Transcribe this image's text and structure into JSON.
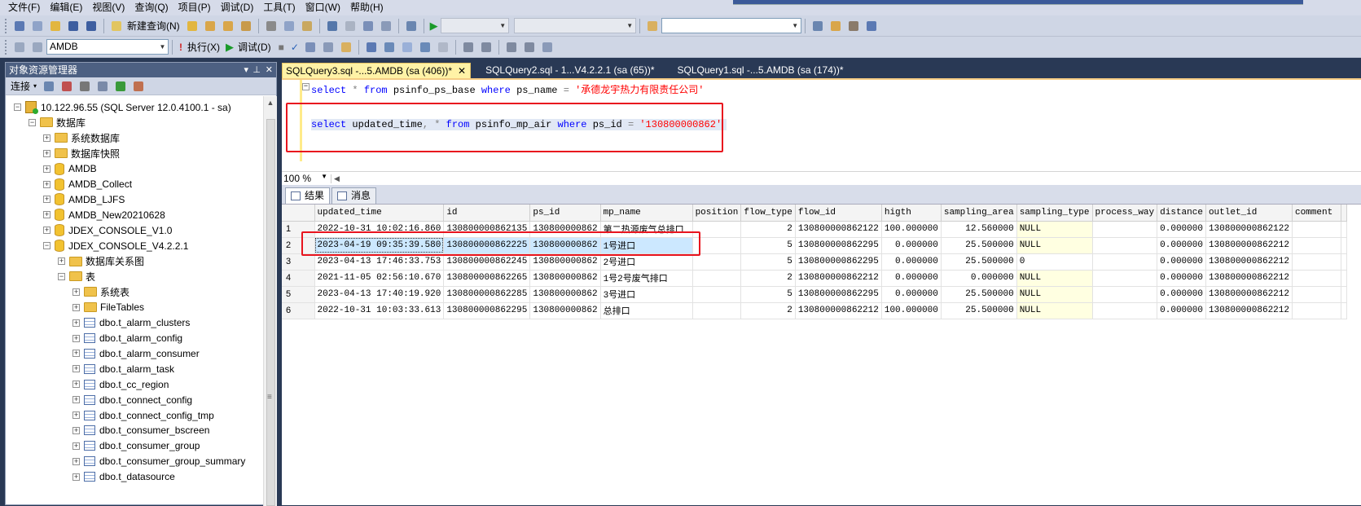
{
  "menu": [
    "文件(F)",
    "编辑(E)",
    "视图(V)",
    "查询(Q)",
    "项目(P)",
    "调试(D)",
    "工具(T)",
    "窗口(W)",
    "帮助(H)"
  ],
  "toolbar1": {
    "new_query": "新建查询(N)"
  },
  "toolbar2": {
    "database": "AMDB",
    "execute": "执行(X)",
    "debug": "调试(D)"
  },
  "explorer": {
    "title": "对象资源管理器",
    "connect": "连接",
    "tree": [
      {
        "label": "10.122.96.55 (SQL Server 12.0.4100.1 - sa)",
        "icon": "server-icon",
        "level": 0,
        "toggle": "−"
      },
      {
        "label": "数据库",
        "icon": "folder-icon",
        "level": 1,
        "toggle": "−"
      },
      {
        "label": "系统数据库",
        "icon": "folder-icon",
        "level": 2,
        "toggle": "+"
      },
      {
        "label": "数据库快照",
        "icon": "folder-icon",
        "level": 2,
        "toggle": "+"
      },
      {
        "label": "AMDB",
        "icon": "database-icon",
        "level": 2,
        "toggle": "+"
      },
      {
        "label": "AMDB_Collect",
        "icon": "database-icon",
        "level": 2,
        "toggle": "+"
      },
      {
        "label": "AMDB_LJFS",
        "icon": "database-icon",
        "level": 2,
        "toggle": "+"
      },
      {
        "label": "AMDB_New20210628",
        "icon": "database-icon",
        "level": 2,
        "toggle": "+"
      },
      {
        "label": "JDEX_CONSOLE_V1.0",
        "icon": "database-icon",
        "level": 2,
        "toggle": "+"
      },
      {
        "label": "JDEX_CONSOLE_V4.2.2.1",
        "icon": "database-icon",
        "level": 2,
        "toggle": "−"
      },
      {
        "label": "数据库关系图",
        "icon": "folder-icon",
        "level": 3,
        "toggle": "+"
      },
      {
        "label": "表",
        "icon": "folder-icon",
        "level": 3,
        "toggle": "−"
      },
      {
        "label": "系统表",
        "icon": "folder-icon",
        "level": 4,
        "toggle": "+"
      },
      {
        "label": "FileTables",
        "icon": "folder-icon",
        "level": 4,
        "toggle": "+"
      },
      {
        "label": "dbo.t_alarm_clusters",
        "icon": "table-icon",
        "level": 4,
        "toggle": "+"
      },
      {
        "label": "dbo.t_alarm_config",
        "icon": "table-icon",
        "level": 4,
        "toggle": "+"
      },
      {
        "label": "dbo.t_alarm_consumer",
        "icon": "table-icon",
        "level": 4,
        "toggle": "+"
      },
      {
        "label": "dbo.t_alarm_task",
        "icon": "table-icon",
        "level": 4,
        "toggle": "+"
      },
      {
        "label": "dbo.t_cc_region",
        "icon": "table-icon",
        "level": 4,
        "toggle": "+"
      },
      {
        "label": "dbo.t_connect_config",
        "icon": "table-icon",
        "level": 4,
        "toggle": "+"
      },
      {
        "label": "dbo.t_connect_config_tmp",
        "icon": "table-icon",
        "level": 4,
        "toggle": "+"
      },
      {
        "label": "dbo.t_consumer_bscreen",
        "icon": "table-icon",
        "level": 4,
        "toggle": "+"
      },
      {
        "label": "dbo.t_consumer_group",
        "icon": "table-icon",
        "level": 4,
        "toggle": "+"
      },
      {
        "label": "dbo.t_consumer_group_summary",
        "icon": "table-icon",
        "level": 4,
        "toggle": "+"
      },
      {
        "label": "dbo.t_datasource",
        "icon": "table-icon",
        "level": 4,
        "toggle": "+"
      }
    ]
  },
  "tabs": [
    {
      "label": "SQLQuery3.sql -...5.AMDB (sa (406))*",
      "active": true
    },
    {
      "label": "SQLQuery2.sql - 1...V4.2.2.1 (sa (65))*",
      "active": false
    },
    {
      "label": "SQLQuery1.sql -...5.AMDB (sa (174))*",
      "active": false
    }
  ],
  "editor": {
    "line1": {
      "kw1": "select",
      "star": " * ",
      "kw2": "from",
      "table": " psinfo_ps_base ",
      "kw3": "where",
      "col": " ps_name ",
      "eq": "=",
      "str": " '承德龙宇热力有限责任公司'"
    },
    "line2": {
      "kw1": "select",
      "cols": " updated_time",
      "comma": ",",
      "star": " * ",
      "kw2": "from",
      "table": " psinfo_mp_air ",
      "kw3": "where",
      "col": " ps_id ",
      "eq": "=",
      "str": " '130800000862'"
    }
  },
  "zoom": "100 %",
  "result_tabs": [
    "结果",
    "消息"
  ],
  "grid": {
    "columns": [
      "updated_time",
      "id",
      "ps_id",
      "mp_name",
      "position",
      "flow_type",
      "flow_id",
      "higth",
      "sampling_area",
      "sampling_type",
      "process_way",
      "distance",
      "outlet_id",
      "comment"
    ],
    "rows": [
      [
        "2022-10-31 10:02:16.860",
        "130800000862135",
        "130800000862",
        "第二热源废气总排口",
        "",
        "2",
        "130800000862122",
        "100.000000",
        "12.560000",
        "NULL",
        "",
        "0.000000",
        "130800000862122",
        ""
      ],
      [
        "2023-04-19 09:35:39.580",
        "130800000862225",
        "130800000862",
        "1号进口",
        "",
        "5",
        "130800000862295",
        "0.000000",
        "25.500000",
        "NULL",
        "",
        "0.000000",
        "130800000862212",
        ""
      ],
      [
        "2023-04-13 17:46:33.753",
        "130800000862245",
        "130800000862",
        "2号进口",
        "",
        "5",
        "130800000862295",
        "0.000000",
        "25.500000",
        "0",
        "",
        "0.000000",
        "130800000862212",
        ""
      ],
      [
        "2021-11-05 02:56:10.670",
        "130800000862265",
        "130800000862",
        "1号2号废气排口",
        "",
        "2",
        "130800000862212",
        "0.000000",
        "0.000000",
        "NULL",
        "",
        "0.000000",
        "130800000862212",
        ""
      ],
      [
        "2023-04-13 17:40:19.920",
        "130800000862285",
        "130800000862",
        "3号进口",
        "",
        "5",
        "130800000862295",
        "0.000000",
        "25.500000",
        "NULL",
        "",
        "0.000000",
        "130800000862212",
        ""
      ],
      [
        "2022-10-31 10:03:33.613",
        "130800000862295",
        "130800000862",
        "总排口",
        "",
        "2",
        "130800000862212",
        "100.000000",
        "25.500000",
        "NULL",
        "",
        "0.000000",
        "130800000862212",
        ""
      ]
    ]
  },
  "colors": {
    "accent": "#4d6082",
    "highlight_box": "#e8141e",
    "selected_row": "#cce8ff",
    "active_tab": "#fff2a6"
  }
}
